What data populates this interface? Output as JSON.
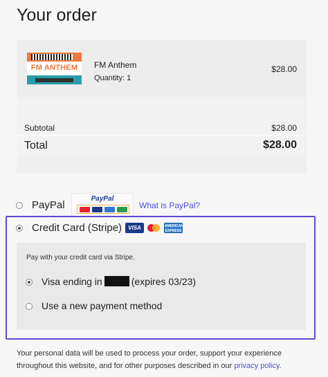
{
  "page": {
    "title": "Your order"
  },
  "order": {
    "item": {
      "name": "FM Anthem",
      "quantity": "Quantity: 1",
      "price": "$28.00",
      "thumbnail_text": "FM ANTHEM"
    },
    "subtotal_label": "Subtotal",
    "subtotal_value": "$28.00",
    "total_label": "Total",
    "total_value": "$28.00"
  },
  "payment": {
    "paypal": {
      "label": "PayPal",
      "logo_text": "PayPal",
      "what_link": "What is PayPal?",
      "selected": false
    },
    "stripe": {
      "label": "Credit Card (Stripe)",
      "visa_text": "VISA",
      "amex_text": "AMERICAN EXPRESS",
      "selected": true,
      "description": "Pay with your credit card via Stripe.",
      "saved_card_prefix": "Visa ending in",
      "saved_card_suffix": "(expires 03/23)",
      "new_method_label": "Use a new payment method"
    },
    "accent_color": "#5b4bd2",
    "link_color": "#4d4de0"
  },
  "privacy": {
    "text": "Your personal data will be used to process your order, support your experience throughout this website, and for other purposes described in our",
    "link": "privacy policy",
    "end": "."
  }
}
